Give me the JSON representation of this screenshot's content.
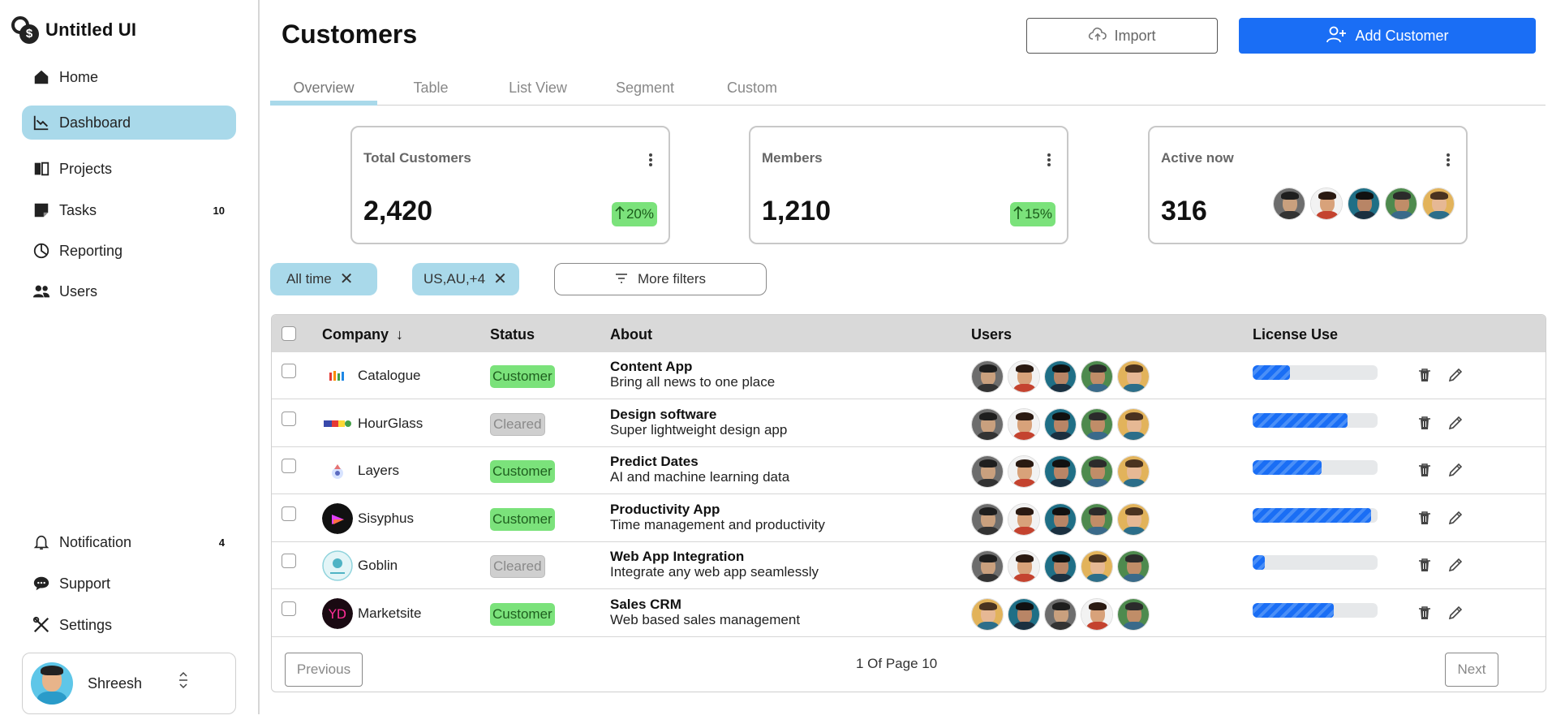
{
  "brand": {
    "name": "Untitled UI",
    "logo_glyph": "$"
  },
  "sidebar": {
    "items": [
      {
        "label": "Home",
        "icon": "home-icon"
      },
      {
        "label": "Dashboard",
        "icon": "chart-line-icon",
        "active": true
      },
      {
        "label": "Projects",
        "icon": "book-icon"
      },
      {
        "label": "Tasks",
        "icon": "sticky-note-icon",
        "badge": "10"
      },
      {
        "label": "Reporting",
        "icon": "pie-chart-icon"
      },
      {
        "label": "Users",
        "icon": "users-icon"
      }
    ],
    "bottom_items": [
      {
        "label": "Notification",
        "icon": "bell-icon",
        "badge": "4"
      },
      {
        "label": "Support",
        "icon": "chat-bubble-icon"
      },
      {
        "label": "Settings",
        "icon": "tools-icon"
      }
    ],
    "user": {
      "name": "Shreesh"
    }
  },
  "header": {
    "title": "Customers",
    "import_label": "Import",
    "add_label": "Add Customer"
  },
  "tabs": [
    {
      "label": "Overview",
      "active": true
    },
    {
      "label": "Table"
    },
    {
      "label": "List View"
    },
    {
      "label": "Segment"
    },
    {
      "label": "Custom"
    }
  ],
  "stats": [
    {
      "label": "Total Customers",
      "value": "2,420",
      "trend": "20%"
    },
    {
      "label": "Members",
      "value": "1,210",
      "trend": "15%"
    },
    {
      "label": "Active now",
      "value": "316"
    }
  ],
  "filters": {
    "chips": [
      "All time",
      "US,AU,+4"
    ],
    "more_label": "More filters"
  },
  "table": {
    "headers": [
      "Company",
      "Status",
      "About",
      "Users",
      "License Use"
    ],
    "sort_indicator": "↓",
    "rows": [
      {
        "company": "Catalogue",
        "status": "Customer",
        "about_title": "Content App",
        "about_desc": "Bring all news to one place",
        "license": 0.3
      },
      {
        "company": "HourGlass",
        "status": "Cleared",
        "about_title": "Design software",
        "about_desc": "Super lightweight design app",
        "license": 0.76
      },
      {
        "company": "Layers",
        "status": "Customer",
        "about_title": "Predict Dates",
        "about_desc": "AI and machine learning data",
        "license": 0.55
      },
      {
        "company": "Sisyphus",
        "status": "Customer",
        "about_title": "Productivity App",
        "about_desc": "Time management and productivity",
        "license": 0.95
      },
      {
        "company": "Goblin",
        "status": "Cleared",
        "about_title": "Web App Integration",
        "about_desc": "Integrate any web app seamlessly",
        "license": 0.1
      },
      {
        "company": "Marketsite",
        "status": "Customer",
        "about_title": "Sales CRM",
        "about_desc": "Web based sales management",
        "license": 0.65
      }
    ]
  },
  "pagination": {
    "previous_label": "Previous",
    "info": "1 Of Page 10",
    "next_label": "Next"
  },
  "colors": {
    "accent": "#1a6ef5",
    "active_nav": "#a9d9ea",
    "customer_badge": "#7be27b",
    "cleared_badge": "#cfcfcf"
  }
}
